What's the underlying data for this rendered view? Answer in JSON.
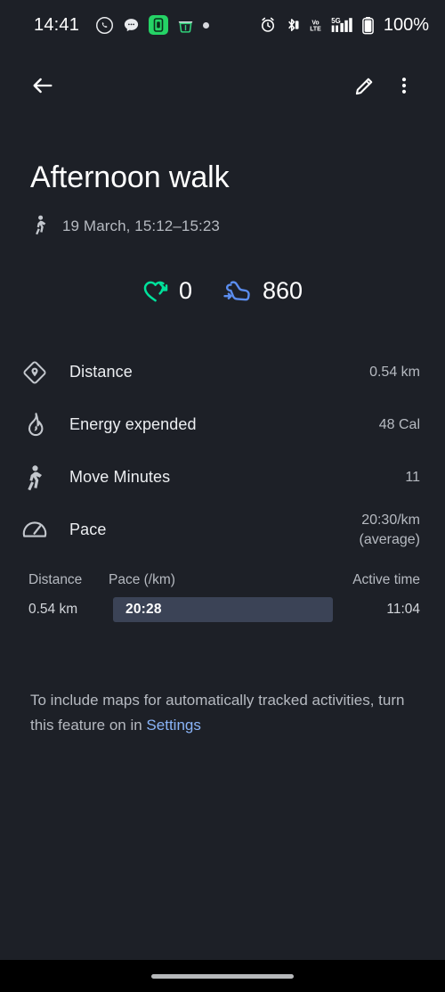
{
  "status_bar": {
    "clock": "14:41",
    "battery_text": "100%",
    "left_icons": [
      "whatsapp-icon",
      "messages-icon",
      "app-green-icon",
      "app-shield-icon",
      "dot-icon"
    ],
    "right_icons": [
      "alarm-icon",
      "bluetooth-icon",
      "volte-icon",
      "signal-5g-icon",
      "battery-icon"
    ]
  },
  "app_bar": {
    "back_icon": "back-arrow-icon",
    "edit_icon": "edit-pencil-icon",
    "overflow_icon": "more-vertical-icon"
  },
  "header": {
    "title": "Afternoon walk",
    "activity_icon": "walking-icon",
    "date_range": "19 March, 15:12–15:23"
  },
  "highlights": [
    {
      "icon": "heart-points-icon",
      "value": "0",
      "color": "#00e19b"
    },
    {
      "icon": "steps-shoe-icon",
      "value": "860",
      "color": "#5b8def"
    }
  ],
  "stats": [
    {
      "icon": "distance-diamond-icon",
      "label": "Distance",
      "value": "0.54 km"
    },
    {
      "icon": "flame-icon",
      "label": "Energy expended",
      "value": "48 Cal"
    },
    {
      "icon": "move-minutes-icon",
      "label": "Move Minutes",
      "value": "11"
    },
    {
      "icon": "pace-gauge-icon",
      "label": "Pace",
      "value": "20:30/km\n(average)"
    }
  ],
  "pace_table": {
    "headers": {
      "distance": "Distance",
      "pace": "Pace (/km)",
      "active_time": "Active time"
    },
    "rows": [
      {
        "distance": "0.54 km",
        "pace": "20:28",
        "active_time": "11:04"
      }
    ]
  },
  "note": {
    "text_before": "To include maps for automatically tracked activities, turn this feature on in ",
    "link_label": "Settings"
  },
  "colors": {
    "background": "#1d2027",
    "accent_green": "#00e19b",
    "accent_blue": "#5b8def",
    "link_blue": "#8ab4f8",
    "bar_fill": "#3b4356"
  }
}
